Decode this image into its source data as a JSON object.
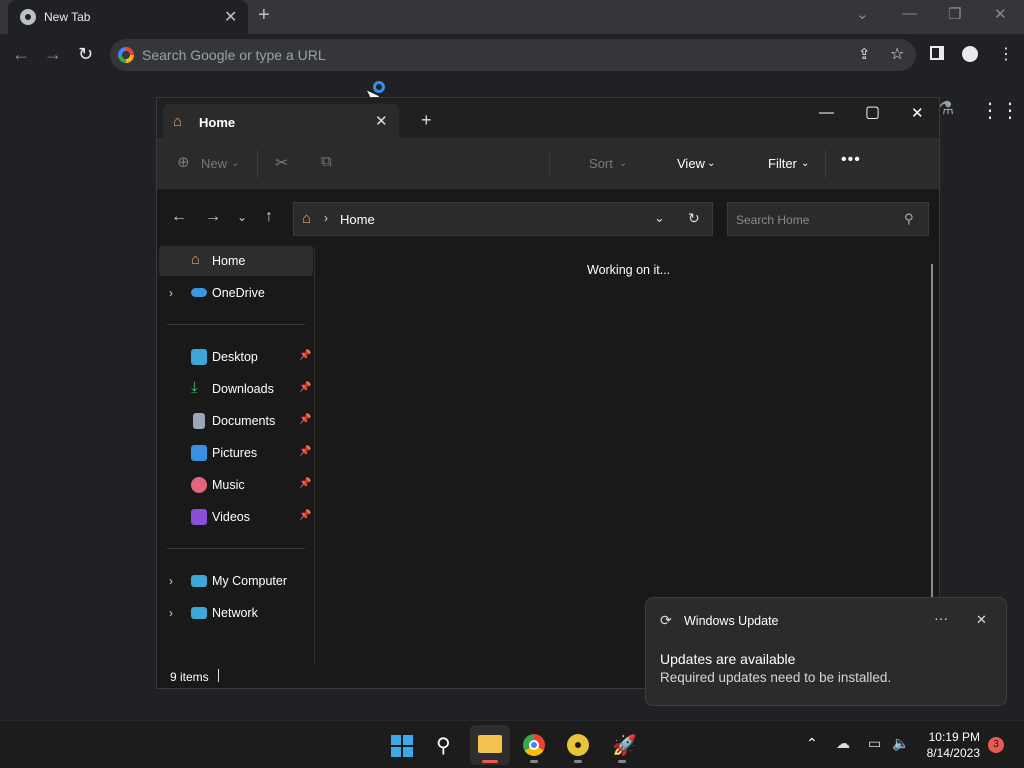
{
  "chrome": {
    "tab_title": "New Tab",
    "omnibox_placeholder": "Search Google or type a URL"
  },
  "explorer": {
    "tab_label": "Home",
    "commandbar": {
      "new_label": "New",
      "sort_label": "Sort",
      "view_label": "View",
      "filter_label": "Filter"
    },
    "address": {
      "crumb": "Home"
    },
    "search_placeholder": "Search Home",
    "nav": {
      "top": [
        {
          "label": "Home",
          "icon": "home-icon",
          "selected": true
        },
        {
          "label": "OneDrive",
          "icon": "cloud-icon",
          "expandable": true
        }
      ],
      "quick_access": [
        {
          "label": "Desktop",
          "icon": "desktop-icon"
        },
        {
          "label": "Downloads",
          "icon": "download-icon"
        },
        {
          "label": "Documents",
          "icon": "document-icon"
        },
        {
          "label": "Pictures",
          "icon": "picture-icon"
        },
        {
          "label": "Music",
          "icon": "music-icon"
        },
        {
          "label": "Videos",
          "icon": "video-icon"
        }
      ],
      "bottom": [
        {
          "label": "My Computer",
          "icon": "computer-icon"
        },
        {
          "label": "Network",
          "icon": "network-icon"
        }
      ]
    },
    "content_status": "Working on it...",
    "status_items": "9 items"
  },
  "toast": {
    "app_name": "Windows Update",
    "title": "Updates are available",
    "body": "Required updates need to be installed."
  },
  "taskbar": {
    "time": "10:19 PM",
    "date": "8/14/2023",
    "notification_count": "3"
  }
}
